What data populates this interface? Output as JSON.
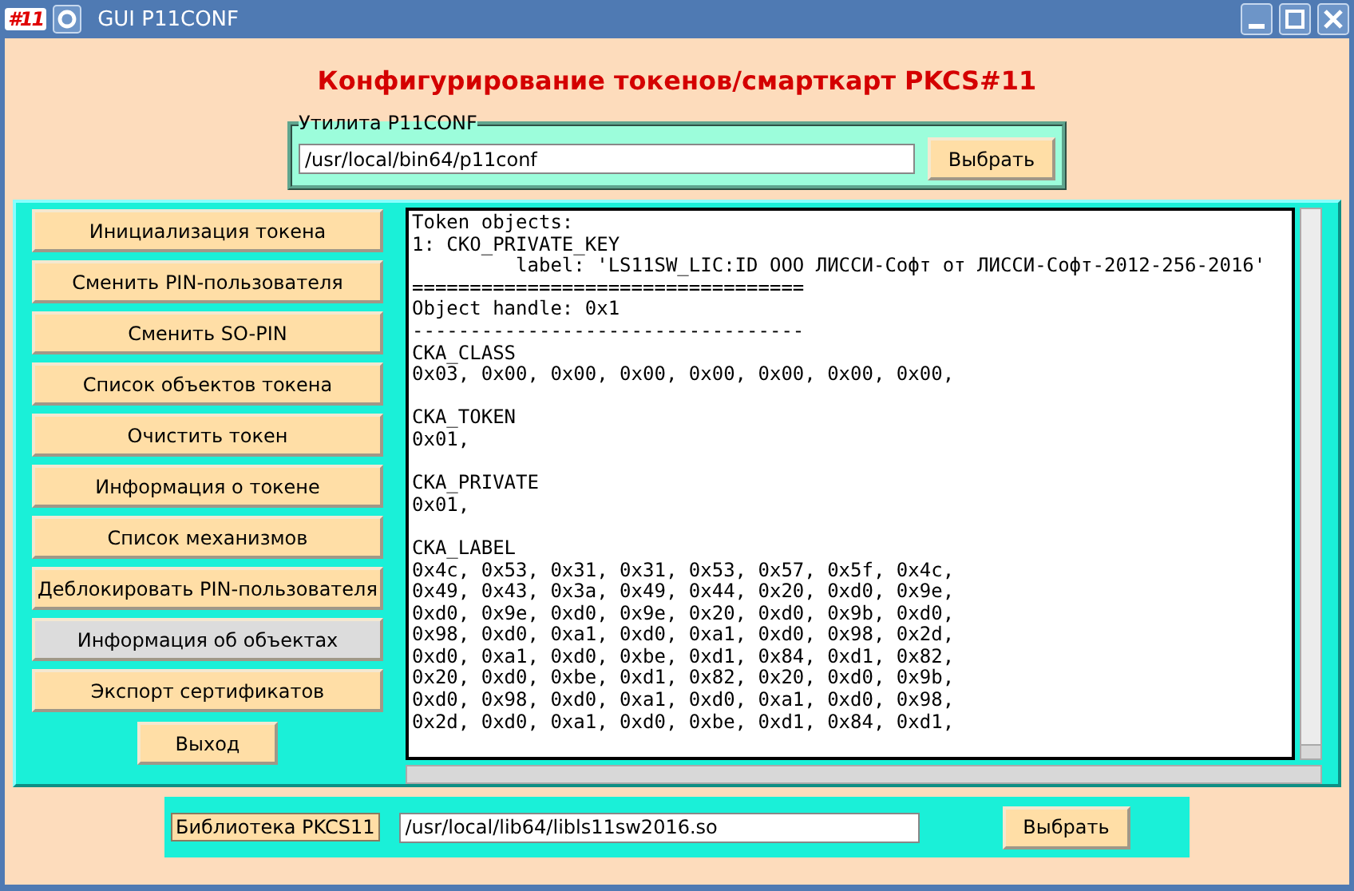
{
  "window": {
    "app_icon": "#11",
    "title": "GUI P11CONF"
  },
  "heading": "Конфигурирование токенов/смарткарт PKCS#11",
  "utility": {
    "legend": "Утилита P11CONF",
    "value": "/usr/local/bin64/p11conf",
    "button": "Выбрать"
  },
  "actions": [
    {
      "label": "Инициализация токена",
      "selected": false
    },
    {
      "label": "Сменить PIN-пользователя",
      "selected": false
    },
    {
      "label": "Сменить SO-PIN",
      "selected": false
    },
    {
      "label": "Список объектов токена",
      "selected": false
    },
    {
      "label": "Очистить токен",
      "selected": false
    },
    {
      "label": "Информация о токене",
      "selected": false
    },
    {
      "label": "Список механизмов",
      "selected": false
    },
    {
      "label": "Деблокировать PIN-пользователя",
      "selected": false
    },
    {
      "label": "Информация об объектах",
      "selected": true
    },
    {
      "label": "Экспорт сертификатов",
      "selected": false
    }
  ],
  "exit_button": "Выход",
  "output": {
    "blocks": [
      {
        "lines": [
          "Token objects:",
          "1: CKO_PRIVATE_KEY",
          "         label: 'LS11SW_LIC:ID ООО ЛИССИ-Софт от ЛИССИ-Софт-2012-256-2016'",
          "==================================",
          "Object handle: 0x1",
          "----------------------------------",
          "CKA_CLASS",
          "0x03, 0x00, 0x00, 0x00, 0x00, 0x00, 0x00, 0x00,"
        ]
      },
      {
        "lines": [
          "CKA_TOKEN",
          "0x01,"
        ]
      },
      {
        "lines": [
          "CKA_PRIVATE",
          "0x01,"
        ]
      },
      {
        "lines": [
          "CKA_LABEL",
          "0x4c, 0x53, 0x31, 0x31, 0x53, 0x57, 0x5f, 0x4c,",
          "0x49, 0x43, 0x3a, 0x49, 0x44, 0x20, 0xd0, 0x9e,",
          "0xd0, 0x9e, 0xd0, 0x9e, 0x20, 0xd0, 0x9b, 0xd0,",
          "0x98, 0xd0, 0xa1, 0xd0, 0xa1, 0xd0, 0x98, 0x2d,",
          "0xd0, 0xa1, 0xd0, 0xbe, 0xd1, 0x84, 0xd1, 0x82,",
          "0x20, 0xd0, 0xbe, 0xd1, 0x82, 0x20, 0xd0, 0x9b,",
          "0xd0, 0x98, 0xd0, 0xa1, 0xd0, 0xa1, 0xd0, 0x98,",
          "0x2d, 0xd0, 0xa1, 0xd0, 0xbe, 0xd1, 0x84, 0xd1,"
        ]
      }
    ]
  },
  "library": {
    "label": "Библиотека PKCS11",
    "value": "/usr/local/lib64/libls11sw2016.so",
    "button": "Выбрать"
  }
}
